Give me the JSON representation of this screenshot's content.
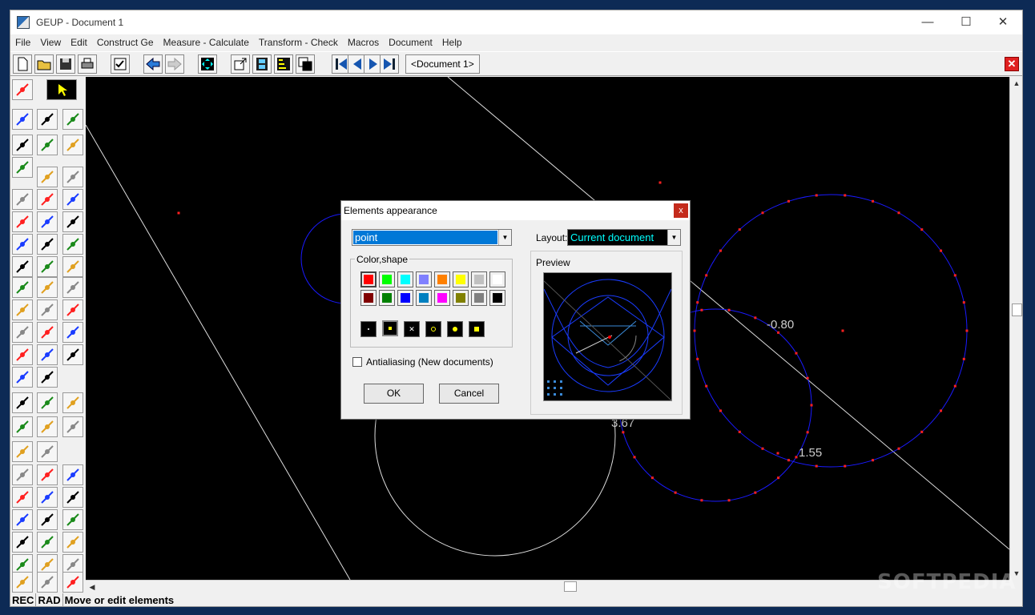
{
  "window": {
    "title": "GEUP - Document 1",
    "minimize_glyph": "—",
    "maximize_glyph": "☐",
    "close_glyph": "✕"
  },
  "menu": [
    "File",
    "View",
    "Edit",
    "Construct Ge",
    "Measure - Calculate",
    "Transform - Check",
    "Macros",
    "Document",
    "Help"
  ],
  "toolbar": {
    "document_tab": "<Document 1>",
    "close_doc_glyph": "✕"
  },
  "canvas": {
    "labels": {
      "a": "-0.80",
      "b": "1.55",
      "c": "3.67"
    }
  },
  "dialog": {
    "title": "Elements appearance",
    "close_glyph": "x",
    "element_type": "point",
    "layout_label": "Layout:",
    "layout_value": "Current document",
    "colorshape_label": "Color,shape",
    "preview_label": "Preview",
    "antialias_label": "Antialiasing (New documents)",
    "antialias_checked": false,
    "ok_label": "OK",
    "cancel_label": "Cancel",
    "colors_row1": [
      "#ff0000",
      "#00ff00",
      "#00ffff",
      "#8080ff",
      "#ff8000",
      "#ffff00",
      "#c0c0c0",
      "#ffffff"
    ],
    "colors_row2": [
      "#800000",
      "#008000",
      "#0000ff",
      "#0080c0",
      "#ff00ff",
      "#808000",
      "#808080",
      "#000000"
    ],
    "selected_color": "#ff0000"
  },
  "status": {
    "rec": "REC",
    "rad": "RAD",
    "message": "Move or edit elements"
  },
  "watermark": "SOFTPEDIA",
  "colors": {
    "canvas_bg": "#000000",
    "selection_blue": "#0078d7",
    "circle_blue": "#1a1aff",
    "point_red": "#ff2020"
  }
}
